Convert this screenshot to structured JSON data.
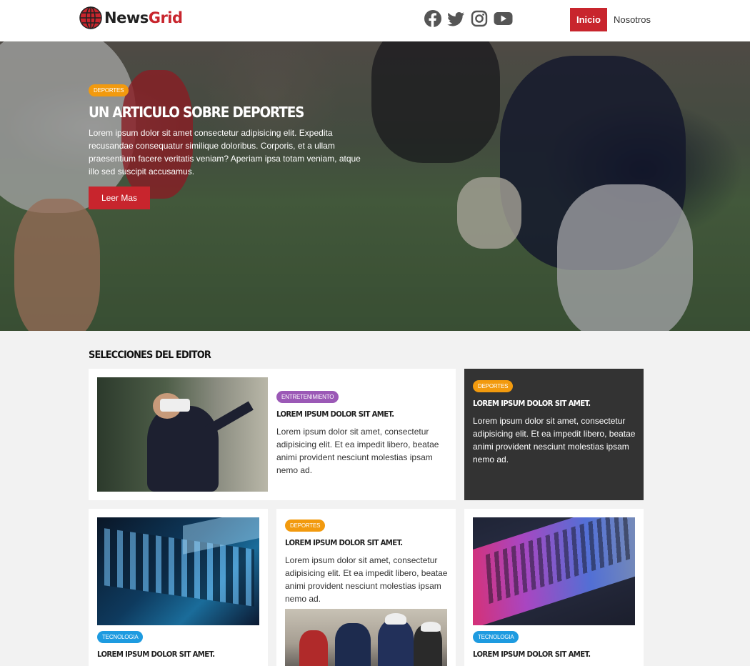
{
  "header": {
    "logo_part1": "News",
    "logo_part2": "Grid",
    "social_icons": [
      "facebook-icon",
      "twitter-icon",
      "instagram-icon",
      "youtube-icon"
    ],
    "nav": [
      {
        "label": "Inicio",
        "active": true
      },
      {
        "label": "Nosotros",
        "active": false
      }
    ]
  },
  "hero": {
    "badge": "Deportes",
    "title": "UN ARTICULO SOBRE DEPORTES",
    "text": "Lorem ipsum dolor sit amet consectetur adipisicing elit. Expedita recusandae consequatur similique doloribus. Corporis, et a ullam praesentium facere veritatis veniam? Aperiam ipsa totam veniam, atque illo sed suscipit accusamus.",
    "button": "Leer Mas"
  },
  "section": {
    "title": "SELECCIONES DEL EDITOR"
  },
  "cards": [
    {
      "badge": "Entretenimiento",
      "title": "LOREM IPSUM DOLOR SIT AMET.",
      "text": "Lorem ipsum dolor sit amet, consectetur adipisicing elit. Et ea impedit libero, beatae animi provident nesciunt molestias ipsam nemo ad."
    },
    {
      "badge": "Deportes",
      "title": "LOREM IPSUM DOLOR SIT AMET.",
      "text": "Lorem ipsum dolor sit amet, consectetur adipisicing elit. Et ea impedit libero, beatae animi provident nesciunt molestias ipsam nemo ad."
    },
    {
      "badge": "Tecnologia",
      "title": "LOREM IPSUM DOLOR SIT AMET."
    },
    {
      "badge": "Deportes",
      "title": "LOREM IPSUM DOLOR SIT AMET.",
      "text": "Lorem ipsum dolor sit amet, consectetur adipisicing elit. Et ea impedit libero, beatae animi provident nesciunt molestias ipsam nemo ad."
    },
    {
      "badge": "Tecnologia",
      "title": "LOREM IPSUM DOLOR SIT AMET."
    }
  ],
  "colors": {
    "brand_red": "#c8252d",
    "badge_orange": "#f29a0e",
    "badge_purple": "#9b59b6",
    "badge_blue": "#1e9be0",
    "dark_card": "#333333"
  }
}
